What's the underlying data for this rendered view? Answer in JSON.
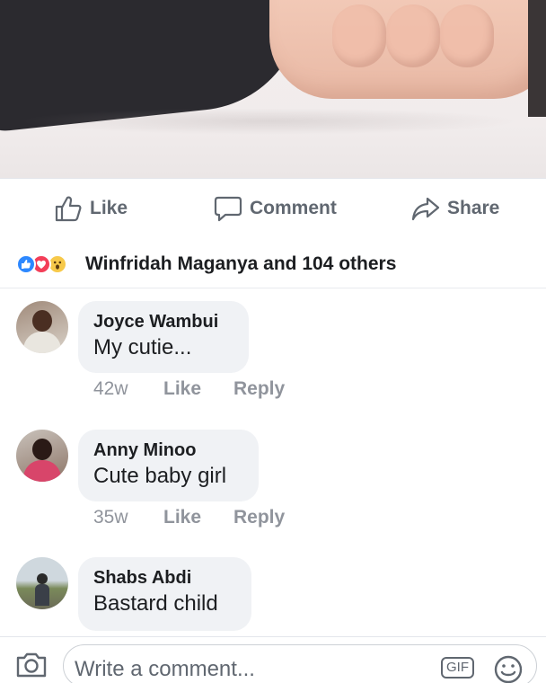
{
  "actions": {
    "like_label": "Like",
    "comment_label": "Comment",
    "share_label": "Share"
  },
  "reactions": {
    "icons": [
      "like-reaction-icon",
      "love-reaction-icon",
      "wow-reaction-icon"
    ],
    "summary": "Winfridah Maganya and 104 others"
  },
  "comments": [
    {
      "author": "Joyce Wambui",
      "text": "My cutie...",
      "time": "42w",
      "like_label": "Like",
      "reply_label": "Reply"
    },
    {
      "author": "Anny Minoo",
      "text": "Cute baby girl",
      "time": "35w",
      "like_label": "Like",
      "reply_label": "Reply"
    },
    {
      "author": "Shabs Abdi",
      "text": "Bastard child"
    }
  ],
  "composer": {
    "placeholder": "Write a comment...",
    "gif_label": "GIF"
  },
  "colors": {
    "like_blue": "#2d88ff",
    "love_red": "#f33e58",
    "wow_yellow": "#f7c94a",
    "secondary_text": "#606770",
    "bubble_bg": "#f0f2f5"
  }
}
